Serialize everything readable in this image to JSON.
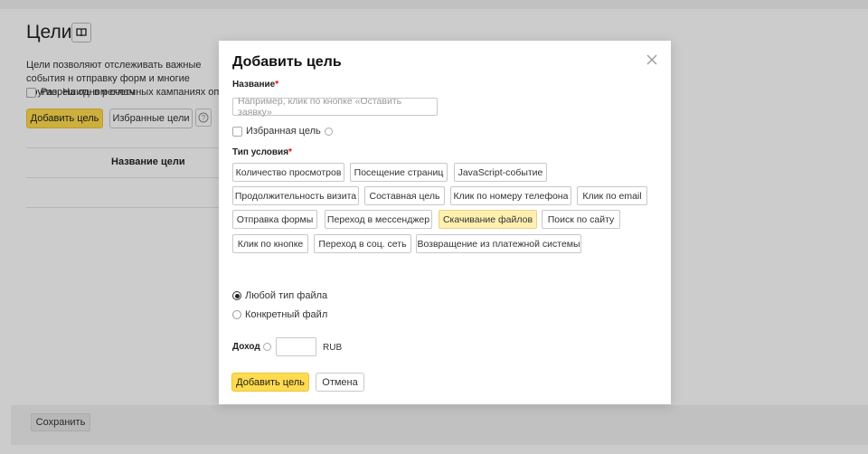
{
  "background": {
    "title": "Цели",
    "description": "Цели позволяют отслеживать важные события н отправку форм и многие другие. На одном счетч",
    "allow_checkbox_label": "Разрешить в рекламных кампаниях оптимиз",
    "add_goal_button": "Добавить цель",
    "favorites_button": "Избранные цели",
    "help_icon": "?",
    "column_header": "Название цели",
    "save_button": "Сохранить"
  },
  "modal": {
    "title": "Добавить цель",
    "name_label": "Название",
    "required_mark": "*",
    "name_placeholder": "Например, клик по кнопке «Оставить заявку»",
    "favorite_label": "Избранная цель",
    "condition_type_label": "Тип условия",
    "condition_types": [
      "Количество просмотров",
      "Посещение страниц",
      "JavaScript-событие",
      "Продолжительность визита",
      "Составная цель",
      "Клик по номеру телефона",
      "Клик по email",
      "Отправка формы",
      "Переход в мессенджер",
      "Скачивание файлов",
      "Поиск по сайту",
      "Клик по кнопке",
      "Переход в соц. сеть",
      "Возвращение из платежной системы"
    ],
    "selected_condition_type": "Скачивание файлов",
    "file_options": [
      "Любой тип файла",
      "Конкретный файл"
    ],
    "selected_file_option": "Любой тип файла",
    "income_label": "Доход",
    "income_value": "",
    "currency": "RUB",
    "add_button": "Добавить цель",
    "cancel_button": "Отмена"
  },
  "colors": {
    "accent_yellow": "#ffdb4d",
    "selected_chip": "#fff0b0",
    "required_red": "#ee0000"
  }
}
